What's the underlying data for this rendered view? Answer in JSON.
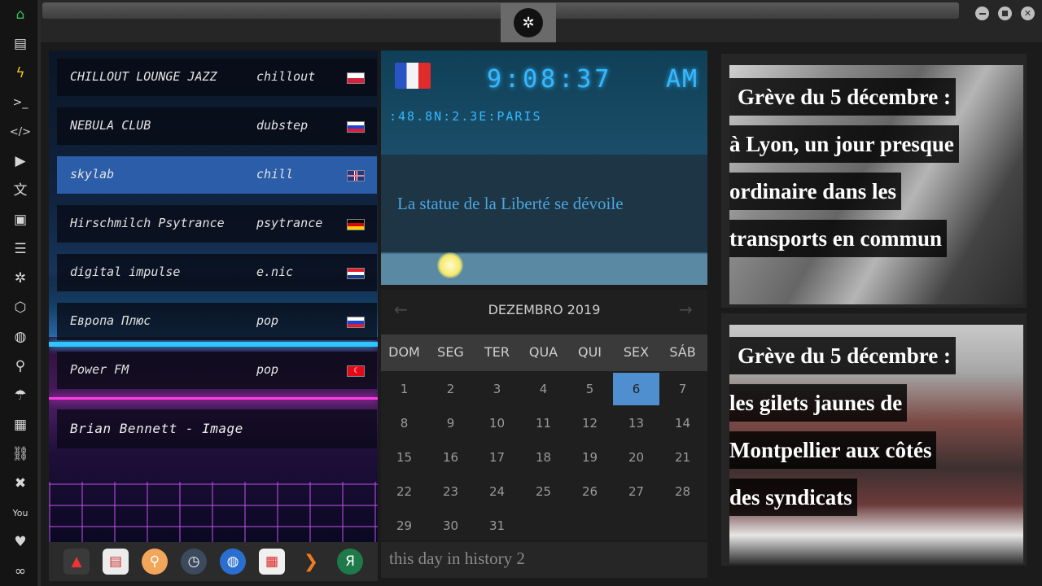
{
  "radio": {
    "stations": [
      {
        "name": "CHILLOUT LOUNGE JAZZ",
        "genre": "chillout",
        "flag": "poland-flag"
      },
      {
        "name": "NEBULA CLUB",
        "genre": "dubstep",
        "flag": "russia-flag"
      },
      {
        "name": "skylab",
        "genre": "chill",
        "flag": "uk-flag",
        "selected": true
      },
      {
        "name": "Hirschmilch Psytrance",
        "genre": "psytrance",
        "flag": "germany-flag"
      },
      {
        "name": "digital impulse",
        "genre": "e.nic",
        "flag": "croatia-flag"
      },
      {
        "name": "Европа Плюс",
        "genre": "pop",
        "flag": "russia-flag"
      },
      {
        "name": "Power FM",
        "genre": "pop",
        "flag": "turkey-flag"
      }
    ],
    "now_playing": "Brian Bennett - Image"
  },
  "clock": {
    "time": "9:08:37",
    "ampm": "AM",
    "coords": ":48.8N:2.3E:PARIS",
    "message": "La statue de la Liberté se dévoile"
  },
  "calendar": {
    "month": "DEZEMBRO 2019",
    "prev": "←",
    "next": "→",
    "weekdays": [
      "DOM",
      "SEG",
      "TER",
      "QUA",
      "QUI",
      "SEX",
      "SÁB"
    ],
    "days": [
      "1",
      "2",
      "3",
      "4",
      "5",
      "6",
      "7",
      "8",
      "9",
      "10",
      "11",
      "12",
      "13",
      "14",
      "15",
      "16",
      "17",
      "18",
      "19",
      "20",
      "21",
      "22",
      "23",
      "24",
      "25",
      "26",
      "27",
      "28",
      "29",
      "30",
      "31"
    ],
    "today": "6"
  },
  "history": {
    "label": "this day in history 2"
  },
  "news": [
    {
      "lines": [
        "Grève du 5 décembre :",
        "à Lyon, un jour presque",
        "ordinaire dans les",
        "transports en commun"
      ]
    },
    {
      "lines": [
        "Grève du 5 décembre :",
        "les gilets jaunes de",
        "Montpellier aux côtés",
        "des syndicats"
      ]
    }
  ],
  "sidebar_icons": [
    "home-icon",
    "document-icon",
    "lightning-icon",
    "terminal-icon",
    "code-icon",
    "play-icon",
    "translate-icon",
    "image-icon",
    "news-icon",
    "rebel-icon",
    "hexagon-icon",
    "globe-icon",
    "search-icon",
    "umbrella-icon",
    "contacts-icon",
    "link-icon",
    "tools-icon",
    "youtube-icon",
    "heart-icon",
    "infinity-icon"
  ],
  "dock_icons": [
    "app-launcher-icon",
    "calendar-news-icon",
    "search-icon",
    "clock-icon",
    "globe-icon",
    "calendar-icon",
    "arrow-icon",
    "yandex-icon"
  ],
  "colors": {
    "accent": "#35b8ff",
    "selected": "#2b5da8",
    "today": "#4f8fcf",
    "active_icon": "#37c15a"
  }
}
